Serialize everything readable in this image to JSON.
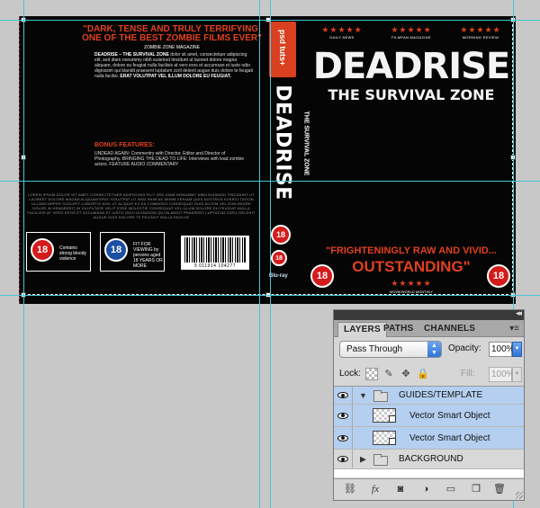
{
  "cover": {
    "back": {
      "quote": "\"DARK, TENSE AND TRULY TERRIFYING. ONE OF THE BEST ZOMBIE FILMS EVER\"",
      "quote_source": "ZOMBIE ZONE MAGAZINE",
      "synopsis_lead": "DEADRISE – THE SURVIVAL ZONE",
      "synopsis_body": "dolor sit amet, consectetuer adipiscing elit, sed diam nonummy nibh euismod tincidunt ut laoreet dolore magna aliquam, dolore eu feugiat nulla facilisis at vero eros et accumsan et iusto odio dignissim qui blandit praesent luptatum zzril delenit augue duis dolore te feugait nulla facilisi.",
      "synopsis_closing": "ERAT VOLUTPAT VEL ILLUM DOLORE EU FEUGIAT.",
      "bonus_title": "BONUS FEATURES:",
      "bonus_body": "UNDEAD AGAIN: Commentry with Director, Editor and Director of Photography. BRINGING THE DEAD TO LIFE: Interviews with lead zombie actors. FEATURE AUDIO COMMENTARY",
      "credits": "LOREM IPSUM DOLOR SIT AMET CONSECTETUER ADIPISCING ELIT SED DIAM NONUMMY NIBH EUISMOD TINCIDUNT UT LAOREET DOLORE MAGNA ALIQUAM ERAT VOLUTPAT UT WISI ENIM AD MINIM VENIAM QUIS NOSTRUD EXERCI TATION ULLAMCORPER SUSCIPIT LOBORTIS NISL UT ALIQUIP EX EA COMMODO CONSEQUAT DUIS AUTEM VEL EUM IRIURE DOLOR IN HENDRERIT IN VULPUTATE VELIT ESSE MOLESTIE CONSEQUAT VEL ILLUM DOLORE EU FEUGIAT NULLA FACILISIS AT VERO EROS ET ACCUMSAN ET IUSTO ODIO DIGNISSIM QUI BLANDIT PRAESENT LUPTATUM ZZRIL DELENIT AUGUE DUIS DOLORE TE FEUGAIT NULLA FACILISI",
      "cert_18": "18",
      "rating1_text": "Contains strong bloody violence",
      "rating2_text": "FIT FOR VIEWING by persons aged 18 YEARS OR MORE",
      "barcode_number": "5 011914 104277"
    },
    "spine": {
      "tag": "psd tuts+",
      "title": "DEADRISE",
      "subtitle": "THE SURVIVAL ZONE",
      "cert": "18",
      "bluray": "Blu-ray"
    },
    "front": {
      "reviews": [
        {
          "stars": "★★★★★",
          "source": "DAILY NEWS"
        },
        {
          "stars": "★★★★★",
          "source": "FILMFAN MAGAZINE"
        },
        {
          "stars": "★★★★★",
          "source": "MORNING REVIEW"
        }
      ],
      "title": "DEADRISE",
      "subtitle": "THE SURVIVAL ZONE",
      "quote_line1": "\"FRIGHTENINGLY RAW AND VIVID...",
      "quote_line2": "OUTSTANDING\"",
      "bottom_stars": "★★★★★",
      "bottom_source": "MOVIEWORLD MONTHLY",
      "cert": "18"
    }
  },
  "layers_panel": {
    "tabs": [
      "LAYERS",
      "PATHS",
      "CHANNELS"
    ],
    "active_tab": "LAYERS",
    "blend_mode": "Pass Through",
    "opacity_label": "Opacity:",
    "opacity_value": "100%",
    "lock_label": "Lock:",
    "fill_label": "Fill:",
    "fill_value": "100%",
    "layers": [
      {
        "name": "GUIDES/TEMPLATE",
        "type": "group",
        "expanded": true,
        "selected": true
      },
      {
        "name": "Vector Smart Object",
        "type": "smart-object",
        "selected": true
      },
      {
        "name": "Vector Smart Object",
        "type": "smart-object",
        "selected": true
      },
      {
        "name": "BACKGROUND",
        "type": "group",
        "expanded": false,
        "selected": false
      }
    ],
    "footer_icons": [
      "link-icon",
      "fx-icon",
      "mask-icon",
      "adjustment-icon",
      "new-group-icon",
      "new-layer-icon",
      "trash-icon"
    ]
  },
  "colors": {
    "accent_red": "#e0401f",
    "guide_cyan": "#46c6d6",
    "selection_blue": "#b4cff0",
    "canvas_bg": "#c8c8c8"
  }
}
